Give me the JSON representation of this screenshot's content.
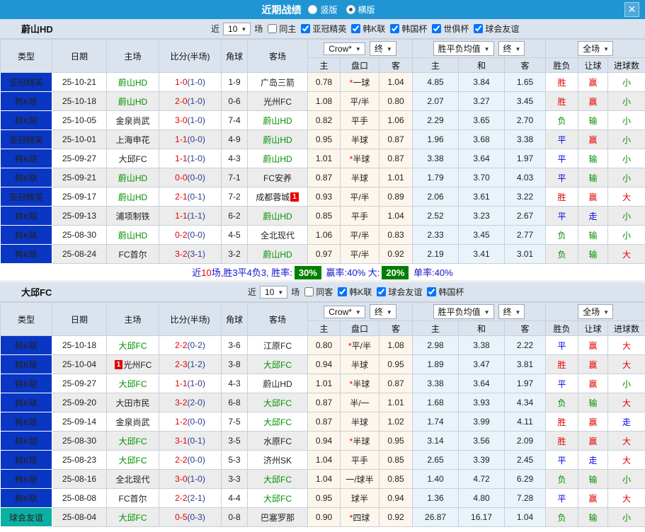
{
  "titlebar": {
    "title": "近期战绩",
    "vertical_label": "竖版",
    "horizontal_label": "横版",
    "selected_layout": "横版",
    "close_glyph": "✕"
  },
  "labels": {
    "near": "近",
    "games": "场"
  },
  "columns": {
    "main": [
      "类型",
      "日期",
      "主场",
      "比分(半场)",
      "角球",
      "客场"
    ],
    "sub": [
      "主",
      "盘口",
      "客",
      "主",
      "和",
      "客",
      "胜负",
      "让球",
      "进球数"
    ],
    "dropdown_group1": [
      "Crow*",
      "终"
    ],
    "dropdown_group2": [
      "胜平负均值",
      "终"
    ],
    "dropdown_group3": [
      "全场"
    ]
  },
  "result_colors": {
    "胜": "red",
    "平": "blue",
    "负": "green",
    "赢": "red",
    "输": "green",
    "走": "blue",
    "大": "red",
    "小": "green"
  },
  "palette": {
    "titlebar": "#2095d3",
    "type_blue": "#0a36c4",
    "type_teal": "#0cb0a2",
    "header_bg": "#dbe4ee",
    "odds_bg": "#fdf6ec",
    "avg_bg": "#e9f3fa",
    "red": "#e60000",
    "green": "#009100",
    "blue": "#0000e6",
    "rate_box": "#008000"
  },
  "sections": [
    {
      "team": "蔚山HD",
      "near": "10",
      "same_label": "同主",
      "same_checked": false,
      "leagues": [
        "亚冠精英",
        "韩K联",
        "韩国杯",
        "世俱杯",
        "球会友谊"
      ],
      "rows": [
        {
          "lg": "亚冠精英",
          "lgc": "blue",
          "dt": "25-10-21",
          "hm": "蔚山HD",
          "hs": true,
          "sc": "1-0",
          "hf": "(1-0)",
          "cn": "1-9",
          "aw": "广岛三箭",
          "as": false,
          "o1": "0.78",
          "st": true,
          "hc": "一球",
          "o2": "1.04",
          "a1": "4.85",
          "a2": "3.84",
          "a3": "1.65",
          "r1": "胜",
          "r2": "赢",
          "r3": "小"
        },
        {
          "lg": "韩K联",
          "lgc": "blue",
          "dt": "25-10-18",
          "hm": "蔚山HD",
          "hs": true,
          "sc": "2-0",
          "hf": "(1-0)",
          "cn": "0-6",
          "aw": "光州FC",
          "as": false,
          "o1": "1.08",
          "st": false,
          "hc": "平/半",
          "o2": "0.80",
          "a1": "2.07",
          "a2": "3.27",
          "a3": "3.45",
          "r1": "胜",
          "r2": "赢",
          "r3": "小"
        },
        {
          "lg": "韩K联",
          "lgc": "blue",
          "dt": "25-10-05",
          "hm": "金泉尚武",
          "hs": false,
          "sc": "3-0",
          "hf": "(1-0)",
          "cn": "7-4",
          "aw": "蔚山HD",
          "as": true,
          "o1": "0.82",
          "st": false,
          "hc": "平手",
          "o2": "1.06",
          "a1": "2.29",
          "a2": "3.65",
          "a3": "2.70",
          "r1": "负",
          "r2": "输",
          "r3": "小"
        },
        {
          "lg": "亚冠精英",
          "lgc": "blue",
          "dt": "25-10-01",
          "hm": "上海申花",
          "hs": false,
          "sc": "1-1",
          "hf": "(0-0)",
          "cn": "4-9",
          "aw": "蔚山HD",
          "as": true,
          "o1": "0.95",
          "st": false,
          "hc": "半球",
          "o2": "0.87",
          "a1": "1.96",
          "a2": "3.68",
          "a3": "3.38",
          "r1": "平",
          "r2": "赢",
          "r3": "小"
        },
        {
          "lg": "韩K联",
          "lgc": "blue",
          "dt": "25-09-27",
          "hm": "大邱FC",
          "hs": false,
          "sc": "1-1",
          "hf": "(1-0)",
          "cn": "4-3",
          "aw": "蔚山HD",
          "as": true,
          "o1": "1.01",
          "st": true,
          "hc": "半球",
          "o2": "0.87",
          "a1": "3.38",
          "a2": "3.64",
          "a3": "1.97",
          "r1": "平",
          "r2": "输",
          "r3": "小"
        },
        {
          "lg": "韩K联",
          "lgc": "blue",
          "dt": "25-09-21",
          "hm": "蔚山HD",
          "hs": true,
          "sc": "0-0",
          "hf": "(0-0)",
          "cn": "7-1",
          "aw": "FC安养",
          "as": false,
          "o1": "0.87",
          "st": false,
          "hc": "半球",
          "o2": "1.01",
          "a1": "1.79",
          "a2": "3.70",
          "a3": "4.03",
          "r1": "平",
          "r2": "输",
          "r3": "小"
        },
        {
          "lg": "亚冠精英",
          "lgc": "blue",
          "dt": "25-09-17",
          "hm": "蔚山HD",
          "hs": true,
          "sc": "2-1",
          "hf": "(0-1)",
          "cn": "7-2",
          "aw": "成都蓉城",
          "as": false,
          "ab": "1",
          "o1": "0.93",
          "st": false,
          "hc": "平/半",
          "o2": "0.89",
          "a1": "2.06",
          "a2": "3.61",
          "a3": "3.22",
          "r1": "胜",
          "r2": "赢",
          "r3": "大"
        },
        {
          "lg": "韩K联",
          "lgc": "blue",
          "dt": "25-09-13",
          "hm": "浦项制铁",
          "hs": false,
          "sc": "1-1",
          "hf": "(1-1)",
          "cn": "6-2",
          "aw": "蔚山HD",
          "as": true,
          "o1": "0.85",
          "st": false,
          "hc": "平手",
          "o2": "1.04",
          "a1": "2.52",
          "a2": "3.23",
          "a3": "2.67",
          "r1": "平",
          "r2": "走",
          "r3": "小"
        },
        {
          "lg": "韩K联",
          "lgc": "blue",
          "dt": "25-08-30",
          "hm": "蔚山HD",
          "hs": true,
          "sc": "0-2",
          "hf": "(0-0)",
          "cn": "4-5",
          "aw": "全北现代",
          "as": false,
          "o1": "1.06",
          "st": false,
          "hc": "平/半",
          "o2": "0.83",
          "a1": "2.33",
          "a2": "3.45",
          "a3": "2.77",
          "r1": "负",
          "r2": "输",
          "r3": "小"
        },
        {
          "lg": "韩K联",
          "lgc": "blue",
          "dt": "25-08-24",
          "hm": "FC首尔",
          "hs": false,
          "sc": "3-2",
          "hf": "(3-1)",
          "cn": "3-2",
          "aw": "蔚山HD",
          "as": true,
          "o1": "0.97",
          "st": false,
          "hc": "平/半",
          "o2": "0.92",
          "a1": "2.19",
          "a2": "3.41",
          "a3": "3.01",
          "r1": "负",
          "r2": "输",
          "r3": "大"
        }
      ],
      "summary_parts": [
        {
          "text": "近",
          "style": "blue"
        },
        {
          "text": "10",
          "style": "red"
        },
        {
          "text": "场,胜3平4负3, 胜率:",
          "style": "blue"
        },
        {
          "text": "30%",
          "style": "box"
        },
        {
          "text": " 赢率:",
          "style": "blue"
        },
        {
          "text": "40%",
          "style": "blue"
        },
        {
          "text": " 大:",
          "style": "blue"
        },
        {
          "text": "20%",
          "style": "box"
        },
        {
          "text": " 单率:",
          "style": "blue"
        },
        {
          "text": "40%",
          "style": "blue"
        }
      ]
    },
    {
      "team": "大邱FC",
      "near": "10",
      "same_label": "同客",
      "same_checked": false,
      "leagues": [
        "韩K联",
        "球会友谊",
        "韩国杯"
      ],
      "rows": [
        {
          "lg": "韩K联",
          "lgc": "blue",
          "dt": "25-10-18",
          "hm": "大邱FC",
          "hs": true,
          "sc": "2-2",
          "hf": "(0-2)",
          "cn": "3-6",
          "aw": "江原FC",
          "as": false,
          "o1": "0.80",
          "st": true,
          "hc": "平/半",
          "o2": "1.08",
          "a1": "2.98",
          "a2": "3.38",
          "a3": "2.22",
          "r1": "平",
          "r2": "赢",
          "r3": "大"
        },
        {
          "lg": "韩K联",
          "lgc": "blue",
          "dt": "25-10-04",
          "hm": "光州FC",
          "hs": false,
          "hb": "1",
          "sc": "2-3",
          "hf": "(1-2)",
          "cn": "3-8",
          "aw": "大邱FC",
          "as": true,
          "o1": "0.94",
          "st": false,
          "hc": "半球",
          "o2": "0.95",
          "a1": "1.89",
          "a2": "3.47",
          "a3": "3.81",
          "r1": "胜",
          "r2": "赢",
          "r3": "大"
        },
        {
          "lg": "韩K联",
          "lgc": "blue",
          "dt": "25-09-27",
          "hm": "大邱FC",
          "hs": true,
          "sc": "1-1",
          "hf": "(1-0)",
          "cn": "4-3",
          "aw": "蔚山HD",
          "as": false,
          "o1": "1.01",
          "st": true,
          "hc": "半球",
          "o2": "0.87",
          "a1": "3.38",
          "a2": "3.64",
          "a3": "1.97",
          "r1": "平",
          "r2": "赢",
          "r3": "小"
        },
        {
          "lg": "韩K联",
          "lgc": "blue",
          "dt": "25-09-20",
          "hm": "大田市民",
          "hs": false,
          "sc": "3-2",
          "hf": "(2-0)",
          "cn": "6-8",
          "aw": "大邱FC",
          "as": true,
          "o1": "0.87",
          "st": false,
          "hc": "半/一",
          "o2": "1.01",
          "a1": "1.68",
          "a2": "3.93",
          "a3": "4.34",
          "r1": "负",
          "r2": "输",
          "r3": "大"
        },
        {
          "lg": "韩K联",
          "lgc": "blue",
          "dt": "25-09-14",
          "hm": "金泉尚武",
          "hs": false,
          "sc": "1-2",
          "hf": "(0-0)",
          "cn": "7-5",
          "aw": "大邱FC",
          "as": true,
          "o1": "0.87",
          "st": false,
          "hc": "半球",
          "o2": "1.02",
          "a1": "1.74",
          "a2": "3.99",
          "a3": "4.11",
          "r1": "胜",
          "r2": "赢",
          "r3": "走"
        },
        {
          "lg": "韩K联",
          "lgc": "blue",
          "dt": "25-08-30",
          "hm": "大邱FC",
          "hs": true,
          "sc": "3-1",
          "hf": "(0-1)",
          "cn": "3-5",
          "aw": "水原FC",
          "as": false,
          "o1": "0.94",
          "st": true,
          "hc": "半球",
          "o2": "0.95",
          "a1": "3.14",
          "a2": "3.56",
          "a3": "2.09",
          "r1": "胜",
          "r2": "赢",
          "r3": "大"
        },
        {
          "lg": "韩K联",
          "lgc": "blue",
          "dt": "25-08-23",
          "hm": "大邱FC",
          "hs": true,
          "sc": "2-2",
          "hf": "(0-0)",
          "cn": "5-3",
          "aw": "济州SK",
          "as": false,
          "o1": "1.04",
          "st": false,
          "hc": "平手",
          "o2": "0.85",
          "a1": "2.65",
          "a2": "3.39",
          "a3": "2.45",
          "r1": "平",
          "r2": "走",
          "r3": "大"
        },
        {
          "lg": "韩K联",
          "lgc": "blue",
          "dt": "25-08-16",
          "hm": "全北现代",
          "hs": false,
          "sc": "3-0",
          "hf": "(1-0)",
          "cn": "3-3",
          "aw": "大邱FC",
          "as": true,
          "o1": "1.04",
          "st": false,
          "hc": "一/球半",
          "o2": "0.85",
          "a1": "1.40",
          "a2": "4.72",
          "a3": "6.29",
          "r1": "负",
          "r2": "输",
          "r3": "小"
        },
        {
          "lg": "韩K联",
          "lgc": "blue",
          "dt": "25-08-08",
          "hm": "FC首尔",
          "hs": false,
          "sc": "2-2",
          "hf": "(2-1)",
          "cn": "4-4",
          "aw": "大邱FC",
          "as": true,
          "o1": "0.95",
          "st": false,
          "hc": "球半",
          "o2": "0.94",
          "a1": "1.36",
          "a2": "4.80",
          "a3": "7.28",
          "r1": "平",
          "r2": "赢",
          "r3": "大"
        },
        {
          "lg": "球会友谊",
          "lgc": "teal",
          "dt": "25-08-04",
          "hm": "大邱FC",
          "hs": true,
          "sc": "0-5",
          "hf": "(0-3)",
          "cn": "0-8",
          "aw": "巴塞罗那",
          "as": false,
          "o1": "0.90",
          "st": true,
          "hc": "四球",
          "o2": "0.92",
          "a1": "26.87",
          "a2": "16.17",
          "a3": "1.04",
          "r1": "负",
          "r2": "输",
          "r3": "小"
        }
      ]
    }
  ]
}
